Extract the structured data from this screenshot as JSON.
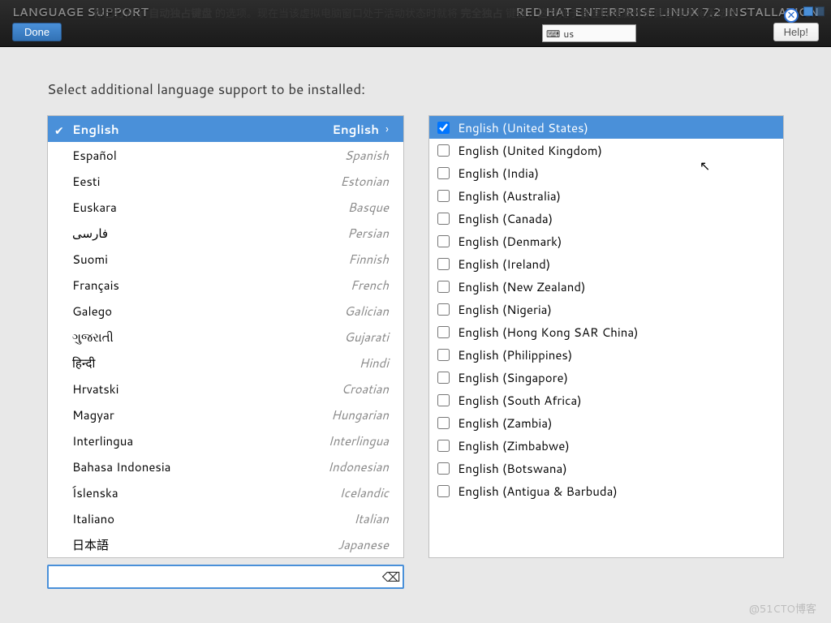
{
  "topbar": {
    "title_left": "LANGUAGE SUPPORT",
    "title_right": "RED HAT ENTERPRISE LINUX 7.2 INSTALLATION",
    "overlay_prefix": "你已打开了",
    "overlay_bold1": "自动独占键盘",
    "overlay_mid": "的选项。现在当该虚拟电脑窗口处于活动状态时就将",
    "overlay_bold2": "完全独占",
    "overlay_suffix": "键盘，这时处于该虚拟电脑外的其它程序将无法使",
    "done_label": "Done",
    "help_label": "Help!",
    "keyboard_indicator": "us"
  },
  "main": {
    "prompt": "Select additional language support to be installed:"
  },
  "languages": [
    {
      "native": "English",
      "eng": "English",
      "selected": true,
      "checked": true
    },
    {
      "native": "Español",
      "eng": "Spanish"
    },
    {
      "native": "Eesti",
      "eng": "Estonian"
    },
    {
      "native": "Euskara",
      "eng": "Basque"
    },
    {
      "native": "فارسی",
      "eng": "Persian"
    },
    {
      "native": "Suomi",
      "eng": "Finnish"
    },
    {
      "native": "Français",
      "eng": "French"
    },
    {
      "native": "Galego",
      "eng": "Galician"
    },
    {
      "native": "ગુજરાતી",
      "eng": "Gujarati"
    },
    {
      "native": "हिन्दी",
      "eng": "Hindi"
    },
    {
      "native": "Hrvatski",
      "eng": "Croatian"
    },
    {
      "native": "Magyar",
      "eng": "Hungarian"
    },
    {
      "native": "Interlingua",
      "eng": "Interlingua"
    },
    {
      "native": "Bahasa Indonesia",
      "eng": "Indonesian"
    },
    {
      "native": "Íslenska",
      "eng": "Icelandic"
    },
    {
      "native": "Italiano",
      "eng": "Italian"
    },
    {
      "native": "日本語",
      "eng": "Japanese"
    }
  ],
  "locales": [
    {
      "label": "English (United States)",
      "checked": true,
      "selected": true
    },
    {
      "label": "English (United Kingdom)"
    },
    {
      "label": "English (India)"
    },
    {
      "label": "English (Australia)"
    },
    {
      "label": "English (Canada)"
    },
    {
      "label": "English (Denmark)"
    },
    {
      "label": "English (Ireland)"
    },
    {
      "label": "English (New Zealand)"
    },
    {
      "label": "English (Nigeria)"
    },
    {
      "label": "English (Hong Kong SAR China)"
    },
    {
      "label": "English (Philippines)"
    },
    {
      "label": "English (Singapore)"
    },
    {
      "label": "English (South Africa)"
    },
    {
      "label": "English (Zambia)"
    },
    {
      "label": "English (Zimbabwe)"
    },
    {
      "label": "English (Botswana)"
    },
    {
      "label": "English (Antigua & Barbuda)"
    }
  ],
  "search": {
    "value": "",
    "placeholder": ""
  },
  "watermark": "@51CTO博客"
}
